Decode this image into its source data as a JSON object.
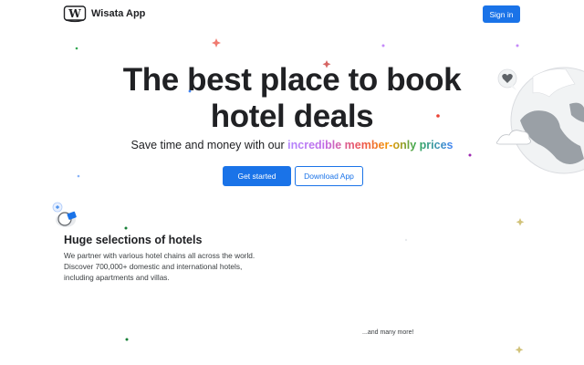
{
  "header": {
    "app_name": "Wisata App",
    "signin_label": "Sign in",
    "logo_icon": "wisata-logo-w"
  },
  "hero": {
    "title_line1": "The best place to book",
    "title_line2": "hotel deals",
    "subtitle_prefix": "Save time and money with our ",
    "subtitle_highlight": "incredible member-only prices",
    "get_started_label": "Get started",
    "download_label": "Download App"
  },
  "features": {
    "title": "Huge selections of hotels",
    "body_line1": "We partner with various hotel chains all across the world.",
    "body_line2": "Discover 700,000+ domestic and international hotels,",
    "body_line3": "including apartments and villas.",
    "more_label": "...and many more!"
  },
  "colors": {
    "primary": "#1a73e8",
    "text": "#202124",
    "gradient": [
      "#b388ff",
      "#c06ae8",
      "#ef5350",
      "#f29900",
      "#34a853",
      "#4285f4"
    ]
  },
  "icons": [
    "wisata-logo-w",
    "globe-illustration",
    "heart-bubble-icon",
    "mascot-illustration",
    "sparkle-icon"
  ]
}
